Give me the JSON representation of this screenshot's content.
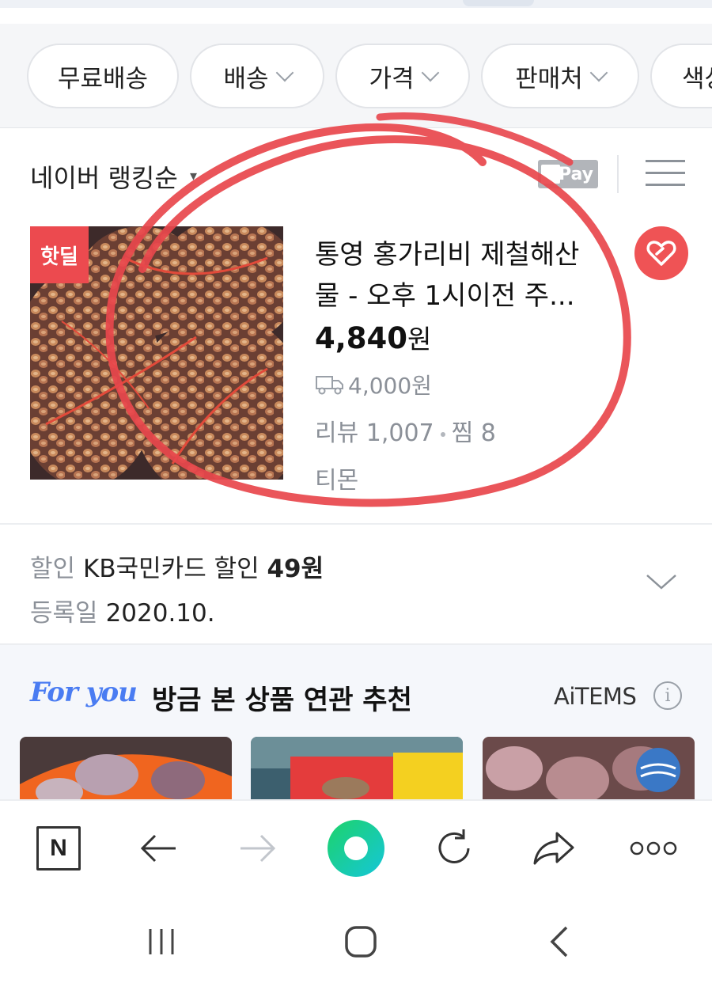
{
  "filters": [
    {
      "label": "무료배송",
      "has_dropdown": false
    },
    {
      "label": "배송",
      "has_dropdown": true
    },
    {
      "label": "가격",
      "has_dropdown": true
    },
    {
      "label": "판매처",
      "has_dropdown": true
    },
    {
      "label": "색상",
      "has_dropdown": false
    }
  ],
  "sort": {
    "label": "네이버 랭킹순",
    "pay_badge": "Pay"
  },
  "product": {
    "badge": "핫딜",
    "title": "통영 홍가리비 제철해산물 - 오후 1시이전 주...",
    "price": "4,840",
    "price_unit": "원",
    "shipping_fee": "4,000원",
    "review_label": "리뷰",
    "review_count": "1,007",
    "zzim_label": "찜",
    "zzim_count": "8",
    "seller": "티몬"
  },
  "benefits": {
    "discount_key": "할인",
    "discount_text": "KB국민카드 할인",
    "discount_amount": "49원",
    "date_key": "등록일",
    "date_value": "2020.10."
  },
  "for_you": {
    "logo": "For you",
    "title": "방금 본 상품 연관 추천",
    "brand": "AiTEMS",
    "info_glyph": "i"
  },
  "colors": {
    "accent_red": "#ef5355",
    "hotdeal_red": "#ec4a4f",
    "foryou_blue": "#4a7cf2",
    "green_start": "#1dd36a",
    "green_end": "#15c6d9"
  },
  "bottom_nav": {
    "icons": [
      "naver-home-icon",
      "back-arrow-icon",
      "forward-arrow-icon",
      "green-dot-icon",
      "refresh-icon",
      "share-icon",
      "more-icon"
    ],
    "n_label": "N",
    "more_label": "ooo"
  },
  "system_nav": {
    "icons": [
      "recent-apps-icon",
      "home-icon",
      "back-icon"
    ]
  }
}
